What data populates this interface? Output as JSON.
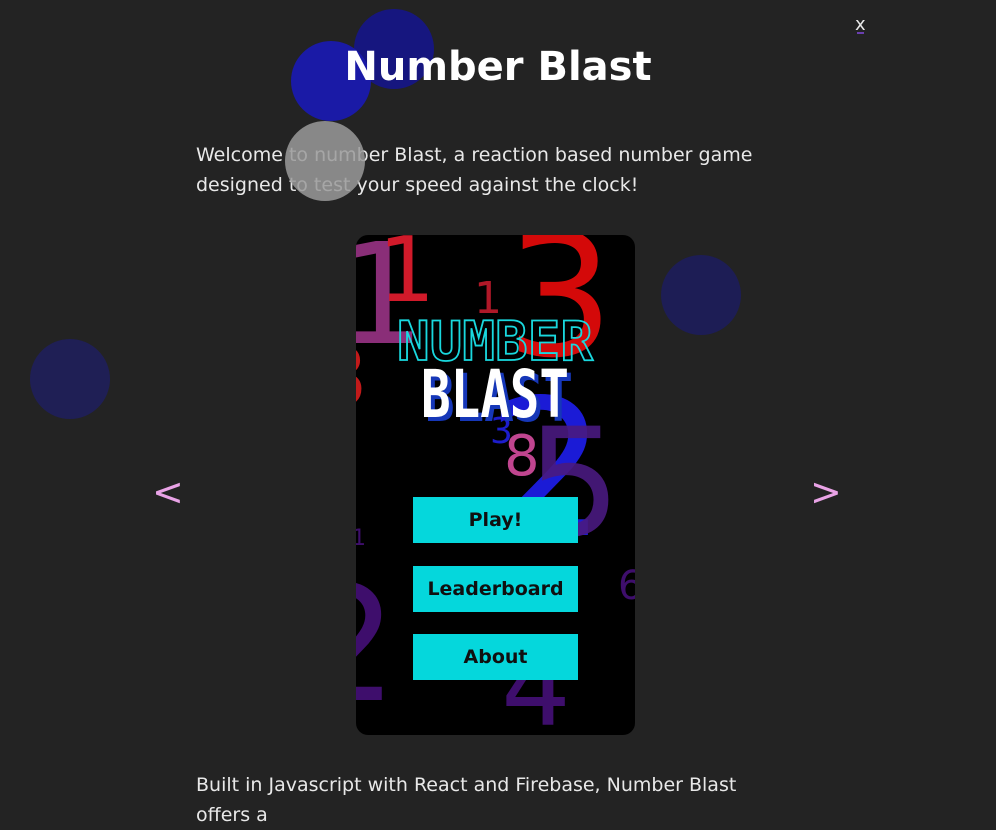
{
  "page": {
    "title": "Number Blast",
    "close_label": "x",
    "description_top": "Welcome to number Blast, a reaction based number game designed to test your speed against the clock!",
    "description_bottom": "Built in Javascript with React and Firebase, Number Blast offers a"
  },
  "carousel": {
    "prev_label": "<",
    "next_label": ">"
  },
  "screenshot": {
    "logo_line1": "NUMBER",
    "logo_line2": "BLAST",
    "buttons": [
      "Play!",
      "Leaderboard",
      "About"
    ],
    "background_digits": [
      "1",
      "1",
      "3",
      "1",
      "8",
      "2",
      "5",
      "3",
      "2",
      "4",
      "6",
      "1"
    ]
  },
  "colors": {
    "page_bg": "#232323",
    "title": "#ffffff",
    "arrow": "#e9a3e6",
    "button_bg": "#05d7dc",
    "logo_outline": "#19d8de",
    "logo_fill": "#ffffff"
  }
}
